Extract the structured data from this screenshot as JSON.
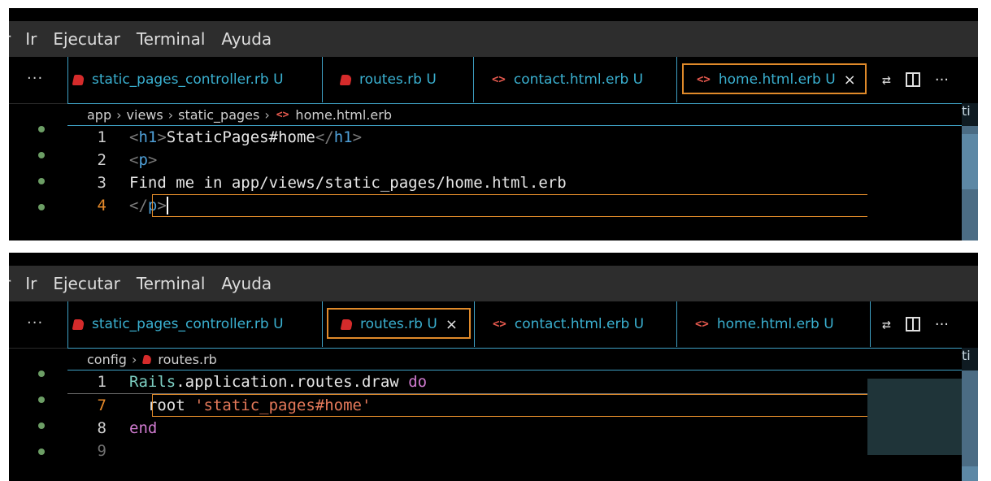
{
  "menu": {
    "items": [
      "r",
      "Ir",
      "Ejecutar",
      "Terminal",
      "Ayuda"
    ]
  },
  "panes": [
    {
      "id": "top",
      "tabs": [
        {
          "label": "static_pages_controller.rb U",
          "icon": "ruby-file-icon",
          "active": false
        },
        {
          "label": "routes.rb U",
          "icon": "ruby-file-icon",
          "active": false
        },
        {
          "label": "contact.html.erb U",
          "icon": "html-file-icon",
          "active": false
        },
        {
          "label": "home.html.erb U",
          "icon": "html-file-icon",
          "active": true
        }
      ],
      "breadcrumb": [
        "app",
        "views",
        "static_pages",
        "home.html.erb"
      ],
      "lines": [
        {
          "num": "1",
          "code": "<h1>StaticPages#home</h1>"
        },
        {
          "num": "2",
          "code": "<p>"
        },
        {
          "num": "3",
          "code": "Find me in app/views/static_pages/home.html.erb"
        },
        {
          "num": "4",
          "code": "</p>"
        }
      ]
    },
    {
      "id": "bottom",
      "tabs": [
        {
          "label": "static_pages_controller.rb U",
          "icon": "ruby-file-icon",
          "active": false
        },
        {
          "label": "routes.rb U",
          "icon": "ruby-file-icon",
          "active": true
        },
        {
          "label": "contact.html.erb U",
          "icon": "html-file-icon",
          "active": false
        },
        {
          "label": "home.html.erb U",
          "icon": "html-file-icon",
          "active": false
        }
      ],
      "breadcrumb": [
        "config",
        "routes.rb"
      ],
      "lines": [
        {
          "num": "1",
          "code": "Rails.application.routes.draw do"
        },
        {
          "num": "7",
          "code": "root 'static_pages#home'"
        },
        {
          "num": "8",
          "code": "end"
        },
        {
          "num": "9",
          "code": ""
        }
      ]
    }
  ],
  "tab_close_glyph": "×",
  "overflow_glyph": "···",
  "more_glyph": "···",
  "icons": {
    "compare": "compare-changes-icon",
    "split": "split-editor-icon",
    "more": "more-actions-icon"
  },
  "colors": {
    "accent_border": "#e08a2a",
    "tab_text": "#3ab0d0",
    "ruby": "#d52b2b"
  }
}
